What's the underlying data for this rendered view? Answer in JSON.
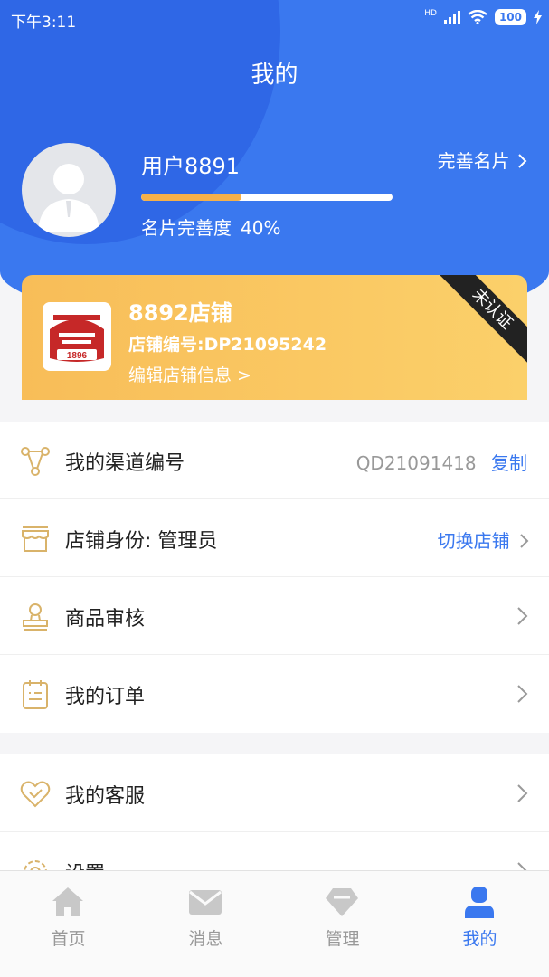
{
  "status_bar": {
    "time": "下午3:11",
    "network": "HD",
    "battery": "100"
  },
  "header": {
    "title": "我的"
  },
  "profile": {
    "username": "用户8891",
    "complete_card": "完善名片",
    "progress_label": "名片完善度",
    "progress_value": "40%",
    "progress_fraction": 0.4
  },
  "shop": {
    "name": "8892店铺",
    "code_label": "店铺编号:",
    "code_value": "DP21095242",
    "edit": "编辑店铺信息 >",
    "ribbon": "未认证",
    "logo_text": "1896"
  },
  "menu": {
    "group1": [
      {
        "label": "我的渠道编号",
        "value": "QD21091418",
        "action": "复制"
      },
      {
        "label": "店铺身份: 管理员",
        "action": "切换店铺"
      },
      {
        "label": "商品审核"
      },
      {
        "label": "我的订单"
      }
    ],
    "group2": [
      {
        "label": "我的客服"
      },
      {
        "label": "设置"
      }
    ]
  },
  "tabs": [
    {
      "label": "首页",
      "icon": "home-icon"
    },
    {
      "label": "消息",
      "icon": "mail-icon"
    },
    {
      "label": "管理",
      "icon": "diamond-icon"
    },
    {
      "label": "我的",
      "icon": "user-icon",
      "active": true
    }
  ],
  "colors": {
    "primary": "#3a78ef",
    "accent": "#f5b04a",
    "icon_gold": "#d9b36a"
  }
}
